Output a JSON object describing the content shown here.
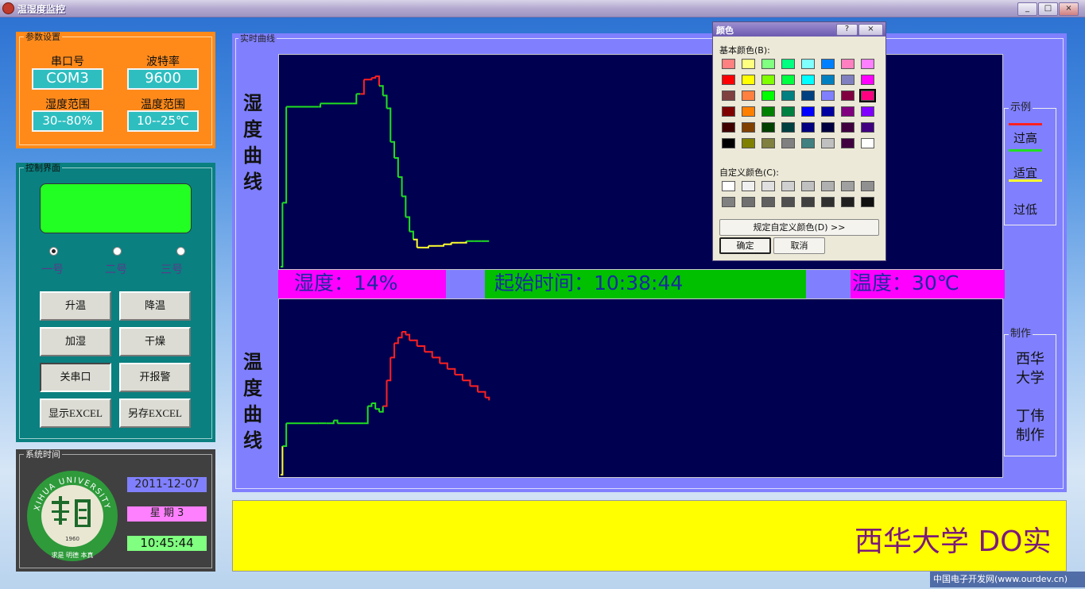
{
  "window": {
    "title": "温湿度监控",
    "buttons": [
      "_",
      "□",
      "×"
    ]
  },
  "params": {
    "title": "参数设置",
    "port_label": "串口号",
    "port_value": "COM3",
    "baud_label": "波特率",
    "baud_value": "9600",
    "hum_range_label": "湿度范围",
    "hum_range_value": "30--80%",
    "temp_range_label": "温度范围",
    "temp_range_value": "10--25℃"
  },
  "control": {
    "title": "控制界面",
    "radios": [
      "一号",
      "二号",
      "三号"
    ],
    "buttons": {
      "heat_up": "升温",
      "cool_down": "降温",
      "humidify": "加湿",
      "dry": "干燥",
      "close_port": "关串口",
      "open_alarm": "开报警",
      "show_excel": "显示EXCEL",
      "save_excel": "另存EXCEL"
    }
  },
  "clock": {
    "title": "系统时间",
    "date": "2011-12-07",
    "weekday": "星 期 3",
    "time": "10:45:44",
    "logo_arc": "XIHUA UNIVERSITY",
    "logo_year": "1960",
    "logo_motto": "求是 明德 本真"
  },
  "realtime": {
    "title": "实时曲线",
    "hum_chart_label": [
      "湿",
      "度",
      "曲",
      "线"
    ],
    "temp_chart_label": [
      "温",
      "度",
      "曲",
      "线"
    ],
    "humidity_text": "湿度：14%",
    "start_time_text": "起始时间：10:38:44",
    "temperature_text": "温度：30℃"
  },
  "legend": {
    "title": "示例",
    "items": [
      {
        "label": "过高",
        "color": "#ff2020"
      },
      {
        "label": "适宜",
        "color": "#20e020"
      },
      {
        "label": "过低",
        "color": "#ffff30"
      }
    ]
  },
  "credits": {
    "title": "制作",
    "line1": "西华",
    "line2": "大学",
    "line3": "丁伟",
    "line4": "制作"
  },
  "marquee": {
    "text": "西华大学 DO实"
  },
  "watermark": "中国电子开发网(www.ourdev.cn)",
  "color_dialog": {
    "title": "颜色",
    "help": "?",
    "close": "×",
    "basic_label": "基本颜色(B):",
    "custom_label": "自定义颜色(C):",
    "define_button": "规定自定义颜色(D) >>",
    "ok_button": "确定",
    "cancel_button": "取消",
    "selected_index": 23,
    "basic_colors": [
      "#ff8080",
      "#ffff80",
      "#80ff80",
      "#00ff80",
      "#80ffff",
      "#0080ff",
      "#ff80c0",
      "#ff80ff",
      "#ff0000",
      "#ffff00",
      "#80ff00",
      "#00ff40",
      "#00ffff",
      "#0080c0",
      "#8080c0",
      "#ff00ff",
      "#804040",
      "#ff8040",
      "#00ff00",
      "#008080",
      "#004080",
      "#8080ff",
      "#800040",
      "#ff0080",
      "#800000",
      "#ff8000",
      "#008000",
      "#008040",
      "#0000ff",
      "#0000a0",
      "#800080",
      "#8000ff",
      "#400000",
      "#804000",
      "#004000",
      "#004040",
      "#000080",
      "#000040",
      "#400040",
      "#400080",
      "#000000",
      "#808000",
      "#808040",
      "#808080",
      "#408080",
      "#c0c0c0",
      "#400040",
      "#ffffff"
    ],
    "custom_colors": [
      "#ffffff",
      "#f0f0f0",
      "#e0e0e0",
      "#d0d0d0",
      "#c0c0c0",
      "#b0b0b0",
      "#a0a0a0",
      "#909090",
      "#808080",
      "#707070",
      "#606060",
      "#505050",
      "#404040",
      "#303030",
      "#202020",
      "#101010"
    ]
  },
  "chart_data": [
    {
      "type": "line",
      "title": "湿度曲线",
      "series": [
        {
          "color": "#ff2020",
          "points": [
            [
              0,
              0
            ],
            [
              1,
              40
            ],
            [
              3,
              100
            ],
            [
              20,
              100
            ],
            [
              21,
              102
            ],
            [
              38,
              102
            ],
            [
              40,
              108
            ],
            [
              42,
              108
            ],
            [
              44,
              117
            ],
            [
              48,
              118
            ],
            [
              50,
              119
            ],
            [
              52,
              113
            ],
            [
              54,
              107
            ],
            [
              56,
              99
            ],
            [
              58,
              78
            ],
            [
              60,
              68
            ],
            [
              62,
              56
            ],
            [
              64,
              44
            ],
            [
              66,
              31
            ],
            [
              68,
              22
            ],
            [
              70,
              17
            ],
            [
              72,
              12
            ],
            [
              74,
              12
            ],
            [
              78,
              13
            ],
            [
              82,
              13
            ],
            [
              86,
              14
            ],
            [
              90,
              15
            ],
            [
              94,
              15
            ],
            [
              98,
              16
            ],
            [
              102,
              16
            ],
            [
              106,
              16
            ],
            [
              110,
              16
            ]
          ]
        }
      ]
    },
    {
      "type": "line",
      "title": "温度曲线",
      "series": [
        {
          "color": "#20e020",
          "points": [
            [
              0,
              0
            ],
            [
              1,
              10
            ],
            [
              3,
              18
            ],
            [
              20,
              18
            ],
            [
              24,
              18
            ],
            [
              28,
              19
            ],
            [
              30,
              18
            ],
            [
              44,
              18
            ],
            [
              46,
              24
            ],
            [
              48,
              25
            ],
            [
              50,
              23
            ],
            [
              52,
              22
            ],
            [
              54,
              24
            ],
            [
              56,
              33
            ],
            [
              58,
              41
            ],
            [
              60,
              46
            ],
            [
              62,
              48
            ],
            [
              64,
              50
            ],
            [
              66,
              49
            ],
            [
              68,
              47
            ],
            [
              72,
              45
            ],
            [
              76,
              43
            ],
            [
              80,
              41
            ],
            [
              84,
              39
            ],
            [
              88,
              37
            ],
            [
              92,
              35
            ],
            [
              96,
              33
            ],
            [
              100,
              31
            ],
            [
              104,
              29
            ],
            [
              108,
              27
            ],
            [
              110,
              26
            ]
          ]
        }
      ]
    }
  ]
}
